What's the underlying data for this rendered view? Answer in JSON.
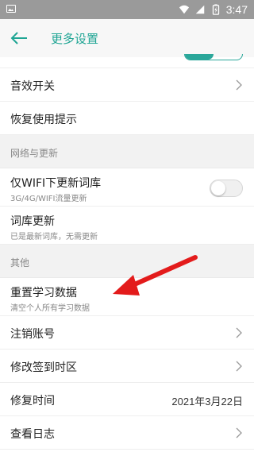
{
  "status_bar": {
    "time": "3:47"
  },
  "app_bar": {
    "title": "更多设置"
  },
  "rows": {
    "sound": {
      "label": "音效开关"
    },
    "restore_tips": {
      "label": "恢复使用提示"
    },
    "section_network": {
      "label": "网络与更新"
    },
    "wifi_only": {
      "label": "仅WIFI下更新词库",
      "sub": "3G/4G/WIFI流量更新",
      "enabled": false
    },
    "lexicon_update": {
      "label": "词库更新",
      "sub": "已是最新词库，无需更新"
    },
    "section_other": {
      "label": "其他"
    },
    "reset_data": {
      "label": "重置学习数据",
      "sub": "清空个人所有学习数据"
    },
    "logout": {
      "label": "注销账号"
    },
    "timezone": {
      "label": "修改签到时区"
    },
    "repair_time": {
      "label": "修复时间",
      "value": "2021年3月22日"
    },
    "logs": {
      "label": "查看日志"
    }
  },
  "colors": {
    "accent": "#1fa594",
    "arrow": "#e31b1b"
  },
  "icons": [
    "back-arrow-icon",
    "chevron-right-icon",
    "wifi-icon",
    "signal-icon",
    "battery-icon",
    "image-icon"
  ]
}
